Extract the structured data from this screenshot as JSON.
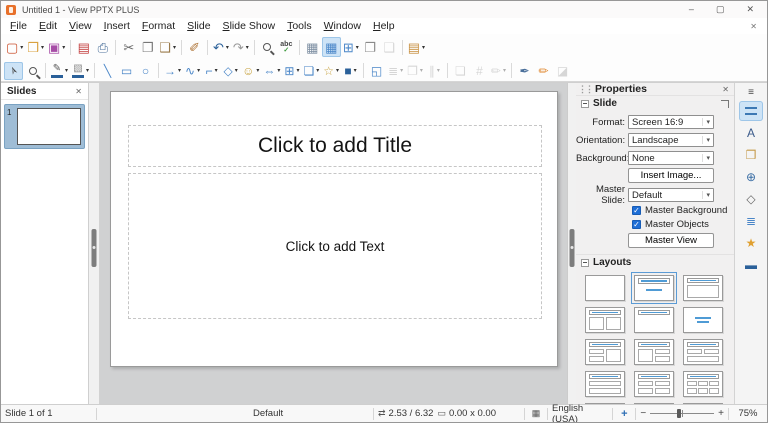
{
  "window": {
    "title": "Untitled 1 - View PPTX PLUS",
    "minimize": "–",
    "maximize": "▢",
    "close": "✕"
  },
  "menubar": {
    "items": [
      "File",
      "Edit",
      "View",
      "Insert",
      "Format",
      "Slide",
      "Slide Show",
      "Tools",
      "Window",
      "Help"
    ],
    "close_document": "✕"
  },
  "toolbar_main": {
    "items": [
      {
        "n": "new-presentation",
        "g": "▢",
        "c": "#cc5533",
        "dd": true
      },
      {
        "n": "open",
        "g": "❒",
        "c": "#d9a13f",
        "dd": true
      },
      {
        "n": "save",
        "g": "▣",
        "c": "#a64ca6",
        "dd": true
      },
      {
        "sep": true
      },
      {
        "n": "export-pdf",
        "g": "▤",
        "c": "#c23b3b"
      },
      {
        "n": "print",
        "g": "⎙",
        "c": "#4a6f9a"
      },
      {
        "sep": true
      },
      {
        "n": "cut",
        "g": "✂",
        "c": "#666666"
      },
      {
        "n": "copy",
        "g": "❐",
        "c": "#777777"
      },
      {
        "n": "paste",
        "g": "❑",
        "c": "#9a7a4a",
        "dd": true
      },
      {
        "sep": true
      },
      {
        "n": "clone-formatting",
        "g": "✐",
        "c": "#b0763a"
      },
      {
        "sep": true
      },
      {
        "n": "undo",
        "g": "↶",
        "c": "#2a6099",
        "dd": true
      },
      {
        "n": "redo",
        "g": "↷",
        "c": "#999999",
        "dd": true
      },
      {
        "sep": true
      },
      {
        "n": "find-and-replace",
        "special": "magnifier"
      },
      {
        "n": "spelling",
        "special": "spelling"
      },
      {
        "sep": true
      },
      {
        "n": "display-grid",
        "g": "▦",
        "c": "#7a8ca0"
      },
      {
        "n": "snap-to-grid",
        "g": "▦",
        "c": "#4a86c8",
        "active": true
      },
      {
        "n": "insert-table",
        "g": "⊞",
        "c": "#4a86c8",
        "dd": true
      },
      {
        "n": "duplicate-slide",
        "g": "❐",
        "c": "#8a8a8a"
      },
      {
        "n": "delete-slide",
        "g": "❑",
        "c": "#999999",
        "disabled": true
      },
      {
        "sep": true
      },
      {
        "n": "slide-properties",
        "g": "▤",
        "c": "#c78f3f",
        "dd": true
      }
    ]
  },
  "toolbar_drawing": {
    "items": [
      {
        "n": "select",
        "special": "cursor",
        "active": true
      },
      {
        "n": "zoom-and-pan",
        "special": "magnifier"
      },
      {
        "sep": true
      },
      {
        "n": "line-color",
        "g": "✎",
        "c": "#555555",
        "bar": "#2a6099",
        "dd": true
      },
      {
        "n": "fill-color",
        "g": "▧",
        "c": "#888888",
        "bar": "#2a6099",
        "dd": true
      },
      {
        "sep": true
      },
      {
        "n": "insert-line",
        "g": "╲",
        "c": "#4a86c8"
      },
      {
        "n": "rectangle",
        "g": "▭",
        "c": "#4a86c8"
      },
      {
        "n": "ellipse",
        "g": "○",
        "c": "#4a86c8"
      },
      {
        "sep": true
      },
      {
        "n": "lines-and-arrows",
        "g": "→",
        "c": "#4a86c8",
        "dd": true
      },
      {
        "n": "curves-and-polygons",
        "g": "∿",
        "c": "#4a86c8",
        "dd": true
      },
      {
        "n": "connectors",
        "g": "⌐",
        "c": "#4a86c8",
        "dd": true
      },
      {
        "n": "basic-shapes",
        "g": "◇",
        "c": "#4a86c8",
        "dd": true
      },
      {
        "n": "symbol-shapes",
        "g": "☺",
        "c": "#c7a23f",
        "dd": true
      },
      {
        "n": "block-arrows",
        "g": "⇔",
        "c": "#4a86c8",
        "dd": true
      },
      {
        "n": "flowchart-shapes",
        "g": "⊞",
        "c": "#4a86c8",
        "dd": true
      },
      {
        "n": "callout-shapes",
        "g": "❏",
        "c": "#4a86c8",
        "dd": true
      },
      {
        "n": "stars-and-banners",
        "g": "☆",
        "c": "#c7a23f",
        "dd": true
      },
      {
        "n": "3d-objects",
        "g": "■",
        "c": "#2a6099",
        "dd": true
      },
      {
        "sep": true
      },
      {
        "n": "rotate",
        "g": "◱",
        "c": "#4a86c8"
      },
      {
        "n": "align-objects",
        "g": "≣",
        "c": "#999999",
        "dd": true,
        "disabled": true
      },
      {
        "n": "arrange",
        "g": "❐",
        "c": "#999999",
        "dd": true,
        "disabled": true
      },
      {
        "n": "distribute-selection",
        "g": "∥",
        "c": "#999999",
        "dd": true,
        "disabled": true
      },
      {
        "sep": true
      },
      {
        "n": "shadow",
        "g": "❏",
        "c": "#999999",
        "disabled": true
      },
      {
        "n": "crop-image",
        "g": "#",
        "c": "#999999",
        "disabled": true
      },
      {
        "n": "image-filter",
        "g": "✏",
        "c": "#999999",
        "dd": true,
        "disabled": true
      },
      {
        "sep": true
      },
      {
        "n": "edit-points",
        "g": "✒",
        "c": "#4a6f9a"
      },
      {
        "n": "glue-points",
        "g": "✏",
        "c": "#e08a33"
      },
      {
        "n": "toggle-extrusion",
        "g": "◪",
        "c": "#999999",
        "disabled": true
      }
    ]
  },
  "slides_panel": {
    "title": "Slides",
    "close": "✕",
    "slides": [
      {
        "number": "1",
        "selected": true
      }
    ]
  },
  "canvas": {
    "title_placeholder": "Click to add Title",
    "text_placeholder": "Click to add Text"
  },
  "sidebar": {
    "header": {
      "title": "Properties",
      "close": "✕"
    },
    "slide_section": {
      "title": "Slide",
      "rows": [
        {
          "label": "Format:",
          "value": "Screen 16:9"
        },
        {
          "label": "Orientation:",
          "value": "Landscape"
        },
        {
          "label": "Background:",
          "value": "None"
        }
      ],
      "insert_image_button": "Insert Image...",
      "master_slide": {
        "label": "Master Slide:",
        "value": "Default"
      },
      "checkboxes": [
        {
          "label": "Master Background",
          "checked": true
        },
        {
          "label": "Master Objects",
          "checked": true
        }
      ],
      "master_view_button": "Master View"
    },
    "layouts_section": {
      "title": "Layouts",
      "items": [
        {
          "name": "blank"
        },
        {
          "name": "title-slide",
          "selected": true
        },
        {
          "name": "title-content"
        },
        {
          "name": "title-2content"
        },
        {
          "name": "title-only"
        },
        {
          "name": "centered-text"
        },
        {
          "name": "2content-content"
        },
        {
          "name": "content-2content"
        },
        {
          "name": "2content-over-content"
        },
        {
          "name": "content-over-content"
        },
        {
          "name": "title-4content"
        },
        {
          "name": "title-6content"
        },
        {
          "name": "vertical-title-text-chart"
        },
        {
          "name": "vertical-title-vertical-text"
        },
        {
          "name": "title-vertical-text"
        }
      ]
    },
    "tabs": [
      {
        "name": "sidebar-settings",
        "glyph": "≡",
        "menu": true
      },
      {
        "name": "properties",
        "special": "sliders",
        "active": true
      },
      {
        "name": "styles",
        "glyph": "A",
        "color": "#3a5a8a"
      },
      {
        "name": "gallery",
        "glyph": "❒",
        "color": "#c59a4a"
      },
      {
        "name": "navigator",
        "glyph": "⊕",
        "color": "#3a6ea5"
      },
      {
        "name": "shapes",
        "glyph": "◇",
        "color": "#666666"
      },
      {
        "name": "slide-transition",
        "glyph": "≣",
        "color": "#4a86c8"
      },
      {
        "name": "animation",
        "glyph": "★",
        "color": "#e0a030"
      },
      {
        "name": "master-slides",
        "glyph": "▬",
        "color": "#2a6099"
      }
    ]
  },
  "statusbar": {
    "slide_info": "Slide 1 of 1",
    "master_name": "Default",
    "position_icon": "⇄",
    "position": "2.53 / 6.32",
    "size_icon": "▭",
    "size": "0.00 x 0.00",
    "save_icon": "▦",
    "language": "English (USA)",
    "fit_icon": "+",
    "zoom_minus": "−",
    "zoom_plus": "+",
    "zoom_value": "75%"
  },
  "colors": {
    "accent_blue": "#4f9bd5",
    "active_button_bg": "#cde3f6",
    "workspace": "#d0d1d2",
    "selection_blue": "#9fbdd6"
  }
}
